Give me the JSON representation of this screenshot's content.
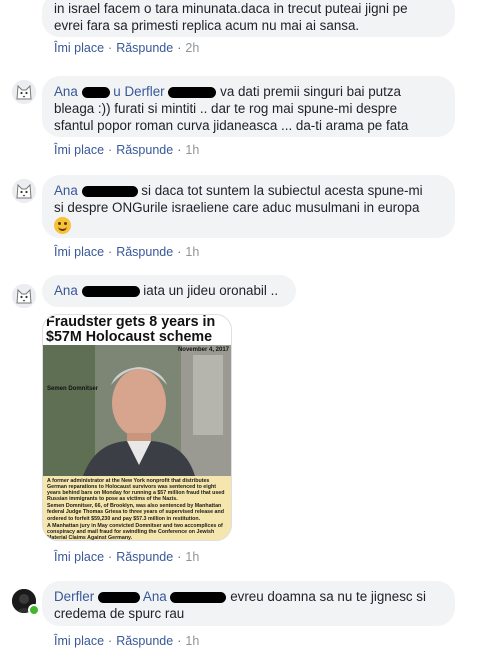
{
  "comments": [
    {
      "text_lines": [
        "in israel facem o tara minunata.daca in trecut puteai jigni pe",
        "evrei fara sa primesti replica acum nu mai ai sansa."
      ],
      "actions": {
        "like": "Îmi place",
        "reply": "Răspunde",
        "time": "2h"
      }
    },
    {
      "author_a": "Ana",
      "author_b": "u Derfler",
      "text_first": "va dati premii singuri bai putza",
      "text_lines": [
        "bleaga :)) furati si mintiti .. dar te rog mai spune-mi despre",
        "sfantul popor roman curva jidaneasca ... da-ti arama pe fata"
      ],
      "actions": {
        "like": "Îmi place",
        "reply": "Răspunde",
        "time": "1h"
      }
    },
    {
      "author": "Ana",
      "text_first": "si daca tot suntem la subiectul acesta spune-mi",
      "text_lines": [
        "si despre ONGurile israeliene care aduc musulmani in europa"
      ],
      "emoji": "smiley-icon",
      "actions": {
        "like": "Îmi place",
        "reply": "Răspunde",
        "time": "1h"
      }
    },
    {
      "author": "Ana",
      "text_first": "iata un jideu oronabil ..",
      "image": {
        "headline_1": "Fraudster gets 8 years in",
        "headline_2": "$57M Holocaust scheme",
        "date": "November 4, 2017",
        "caption": "Semen Domnitser",
        "paragraphs": [
          "A former administrator at the New York nonprofit that distributes German reparations to Holocaust survivors was sentenced to eight years behind bars on Monday for running a $57 million fraud that used Russian immigrants to pose as victims of the Nazis.",
          "Semen Domnitser, 66, of Brooklyn, was also sentenced by Manhattan federal Judge Thomas Griesa to three years of supervised release and ordered to forfeit $59,230 and pay $57.3 million in restitution.",
          "A Manhattan jury in May convicted Domnitser and two accomplices of conspiracy and mail fraud for swindling the Conference on Jewish Material Claims Against Germany."
        ]
      },
      "actions": {
        "like": "Îmi place",
        "reply": "Răspunde",
        "time": "1h"
      }
    },
    {
      "author": "Derfler",
      "mention": "Ana",
      "text_first": "evreu doamna sa nu te jignesc si",
      "text_lines": [
        "credema de spurc rau"
      ],
      "actions": {
        "like": "Îmi place",
        "reply": "Răspunde",
        "time": "1h"
      }
    }
  ],
  "colors": {
    "link": "#385898",
    "bubble": "#f2f3f5",
    "meta": "#606770",
    "online": "#42b72a"
  }
}
